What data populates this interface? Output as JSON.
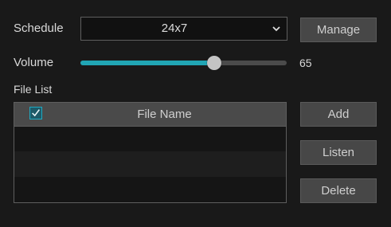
{
  "schedule": {
    "label": "Schedule",
    "selected": "24x7",
    "manage_label": "Manage"
  },
  "volume": {
    "label": "Volume",
    "value": 65,
    "value_text": "65",
    "min": 0,
    "max": 100,
    "accent": "#21a5b4"
  },
  "file_list": {
    "label": "File List",
    "header": {
      "column": "File Name",
      "select_all_checked": true
    },
    "rows": [],
    "buttons": {
      "add": "Add",
      "listen": "Listen",
      "delete": "Delete"
    }
  }
}
